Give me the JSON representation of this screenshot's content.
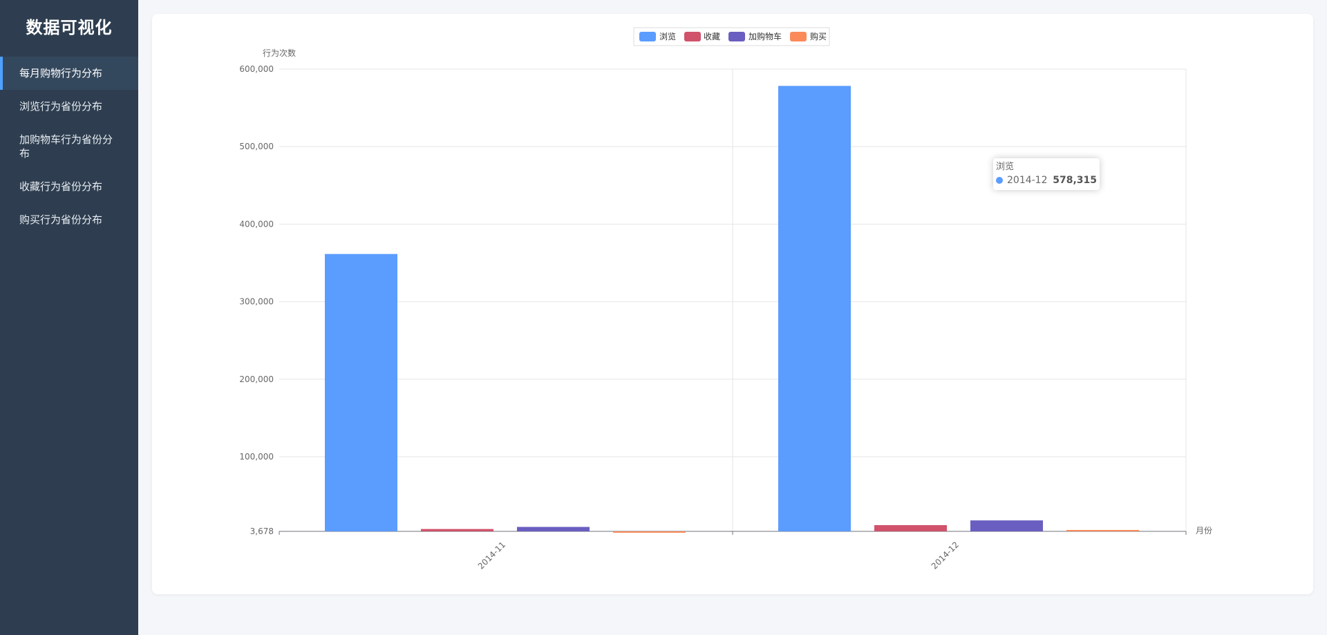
{
  "app": {
    "title": "数据可视化"
  },
  "sidebar": {
    "items": [
      {
        "label": "每月购物行为分布",
        "active": true
      },
      {
        "label": "浏览行为省份分布",
        "active": false
      },
      {
        "label": "加购物车行为省份分布",
        "active": false
      },
      {
        "label": "收藏行为省份分布",
        "active": false
      },
      {
        "label": "购买行为省份分布",
        "active": false
      }
    ]
  },
  "colors": {
    "browse": "#5b9cff",
    "collect": "#d0526b",
    "cart": "#6a5ec0",
    "buy": "#fa8a5a"
  },
  "tooltip": {
    "series": "浏览",
    "category": "2014-12",
    "value": "578,315"
  },
  "chart_data": {
    "type": "bar",
    "categories": [
      "2014-11",
      "2014-12"
    ],
    "series": [
      {
        "name": "浏览",
        "values": [
          361500,
          578315
        ]
      },
      {
        "name": "收藏",
        "values": [
          6700,
          11700
        ]
      },
      {
        "name": "加购物车",
        "values": [
          9400,
          17800
        ]
      },
      {
        "name": "购买",
        "values": [
          2800,
          5500
        ]
      }
    ],
    "xlabel": "月份",
    "ylabel": "行为次数",
    "ylim": [
      3678,
      600000
    ],
    "yticks": [
      3678,
      100000,
      200000,
      300000,
      400000,
      500000,
      600000
    ],
    "ytick_labels": [
      "3,678",
      "100,000",
      "200,000",
      "300,000",
      "400,000",
      "500,000",
      "600,000"
    ],
    "legend": "top-center",
    "grid": true
  }
}
